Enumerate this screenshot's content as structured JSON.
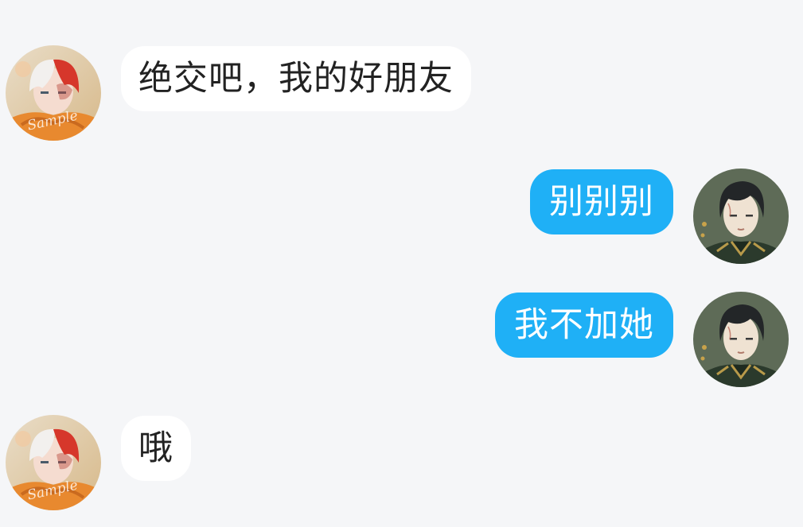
{
  "colors": {
    "background": "#f5f6f8",
    "incoming_bubble": "#ffffff",
    "outgoing_bubble": "#1fb0f6",
    "incoming_text": "#222222",
    "outgoing_text": "#ffffff"
  },
  "messages": [
    {
      "direction": "incoming",
      "text": "绝交吧，我的好朋友",
      "avatar": "white-red-hair-boy-avatar"
    },
    {
      "direction": "outgoing",
      "text": "别别别",
      "avatar": "dark-hair-uniform-avatar"
    },
    {
      "direction": "outgoing",
      "text": "我不加她",
      "avatar": "dark-hair-uniform-avatar"
    },
    {
      "direction": "incoming",
      "text": "哦",
      "avatar": "white-red-hair-boy-avatar"
    }
  ],
  "avatar_watermark": "Sample"
}
